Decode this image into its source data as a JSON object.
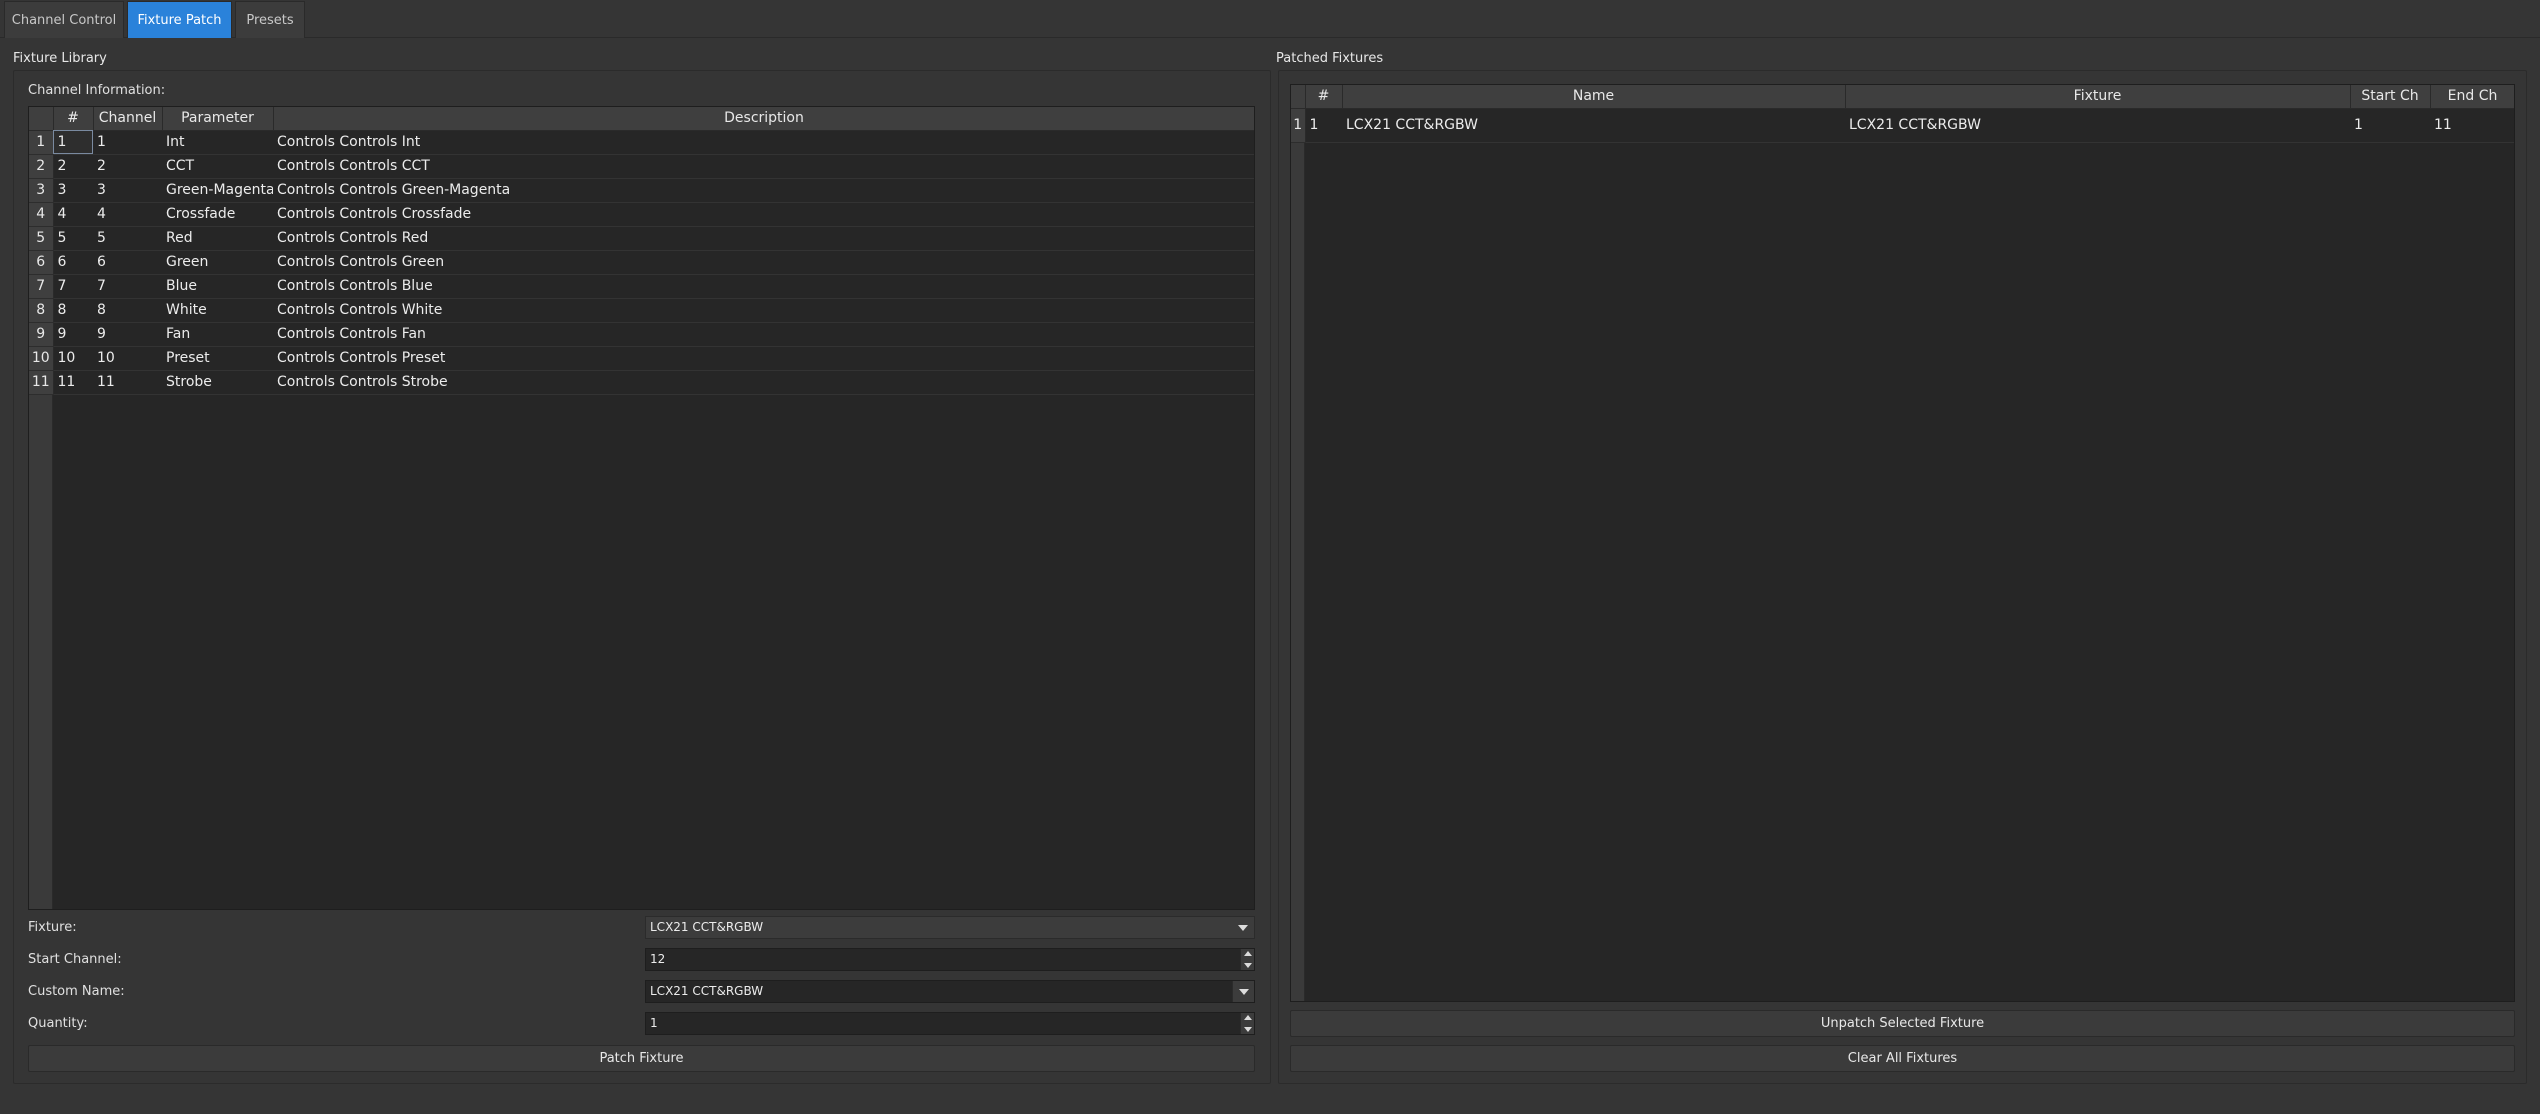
{
  "tabs": [
    {
      "label": "Channel Control"
    },
    {
      "label": "Fixture Patch"
    },
    {
      "label": "Presets"
    }
  ],
  "library": {
    "title": "Fixture Library",
    "channel_info_label": "Channel Information:",
    "columns": [
      "#",
      "Channel",
      "Parameter",
      "Description"
    ],
    "rows": [
      {
        "row": "1",
        "num": "1",
        "channel": "1",
        "parameter": "Int",
        "description": "Controls Controls Int"
      },
      {
        "row": "2",
        "num": "2",
        "channel": "2",
        "parameter": "CCT",
        "description": "Controls Controls CCT"
      },
      {
        "row": "3",
        "num": "3",
        "channel": "3",
        "parameter": "Green-Magenta",
        "description": "Controls Controls Green-Magenta"
      },
      {
        "row": "4",
        "num": "4",
        "channel": "4",
        "parameter": "Crossfade",
        "description": "Controls Controls Crossfade"
      },
      {
        "row": "5",
        "num": "5",
        "channel": "5",
        "parameter": "Red",
        "description": "Controls Controls Red"
      },
      {
        "row": "6",
        "num": "6",
        "channel": "6",
        "parameter": "Green",
        "description": "Controls Controls Green"
      },
      {
        "row": "7",
        "num": "7",
        "channel": "7",
        "parameter": "Blue",
        "description": "Controls Controls Blue"
      },
      {
        "row": "8",
        "num": "8",
        "channel": "8",
        "parameter": "White",
        "description": "Controls Controls White"
      },
      {
        "row": "9",
        "num": "9",
        "channel": "9",
        "parameter": "Fan",
        "description": "Controls Controls Fan"
      },
      {
        "row": "10",
        "num": "10",
        "channel": "10",
        "parameter": "Preset",
        "description": "Controls Controls Preset"
      },
      {
        "row": "11",
        "num": "11",
        "channel": "11",
        "parameter": "Strobe",
        "description": "Controls Controls Strobe"
      }
    ],
    "form": {
      "fixture_label": "Fixture:",
      "fixture_value": "LCX21 CCT&RGBW",
      "start_channel_label": "Start Channel:",
      "start_channel_value": "12",
      "custom_name_label": "Custom Name:",
      "custom_name_value": "LCX21 CCT&RGBW",
      "quantity_label": "Quantity:",
      "quantity_value": "1"
    },
    "patch_button": "Patch Fixture"
  },
  "patched": {
    "title": "Patched Fixtures",
    "columns": [
      "#",
      "Name",
      "Fixture",
      "Start Ch",
      "End Ch"
    ],
    "rows": [
      {
        "row": "1",
        "num": "1",
        "name": "LCX21 CCT&RGBW",
        "fixture": "LCX21 CCT&RGBW",
        "start": "1",
        "end": "11"
      }
    ],
    "unpatch_button": "Unpatch Selected Fixture",
    "clear_button": "Clear All Fixtures"
  },
  "colors": {
    "accent": "#2a82da",
    "background": "#353535",
    "table_bg": "#262626"
  }
}
